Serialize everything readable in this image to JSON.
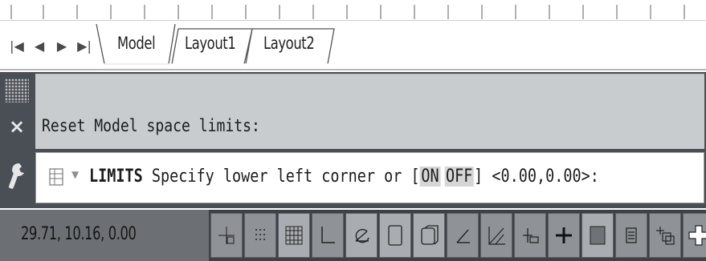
{
  "tabs": {
    "items": [
      {
        "label": "Model",
        "active": true
      },
      {
        "label": "Layout1",
        "active": false
      },
      {
        "label": "Layout2",
        "active": false
      }
    ]
  },
  "command": {
    "history_line": "Reset Model space limits:",
    "prompt_command": "LIMITS",
    "prompt_text_before": "Specify lower left corner or [",
    "option_on": "ON",
    "option_off": "OFF",
    "prompt_text_after": "] <0.00,0.00>:"
  },
  "statusbar": {
    "coordinates": "29.71, 10.16, 0.00",
    "toggles": [
      {
        "icon": "infer-constraints-icon"
      },
      {
        "icon": "snap-mode-icon"
      },
      {
        "icon": "grid-display-icon"
      },
      {
        "icon": "ortho-mode-icon"
      },
      {
        "icon": "polar-tracking-icon"
      },
      {
        "icon": "object-snap-icon"
      },
      {
        "icon": "3d-object-snap-icon"
      },
      {
        "icon": "object-snap-tracking-icon"
      },
      {
        "icon": "dynamic-ucs-icon"
      },
      {
        "icon": "dynamic-input-icon"
      },
      {
        "icon": "lineweight-icon"
      },
      {
        "icon": "transparency-icon"
      },
      {
        "icon": "quick-properties-icon"
      },
      {
        "icon": "selection-cycling-icon"
      },
      {
        "icon": "annotation-monitor-icon"
      }
    ]
  }
}
